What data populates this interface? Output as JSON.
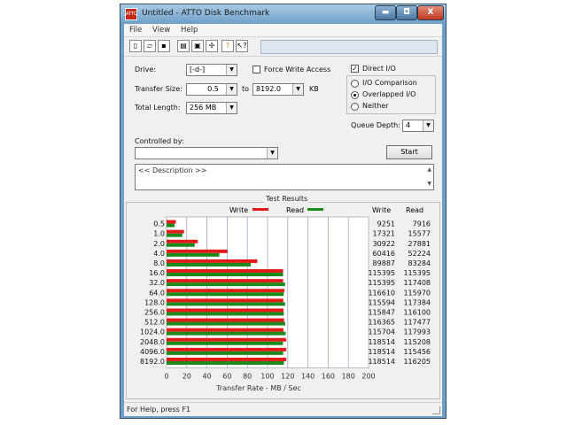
{
  "window": {
    "title": "Untitled - ATTO Disk Benchmark",
    "icon_name": "atto-app-icon",
    "controls": {
      "minimize": "▬",
      "maximize": "◘",
      "close": "X"
    }
  },
  "menu": [
    "File",
    "View",
    "Help"
  ],
  "toolbar": {
    "icons": [
      "new-document-icon",
      "open-folder-icon",
      "save-icon",
      "print-icon",
      "print-preview-icon",
      "move-icon",
      "help-icon",
      "context-help-icon"
    ],
    "glyphs": [
      "▯",
      "▱",
      "▪",
      "▤",
      "▣",
      "✢",
      "?",
      "↖?"
    ]
  },
  "settings": {
    "drive_label": "Drive:",
    "drive_value": "[-d-]",
    "force_write_label": "Force Write Access",
    "force_write_checked": false,
    "direct_io_label": "Direct I/O",
    "direct_io_checked": true,
    "transfer_size_label": "Transfer Size:",
    "transfer_min": "0.5",
    "to_label": "to",
    "transfer_max": "8192.0",
    "unit": "KB",
    "total_length_label": "Total Length:",
    "total_length_value": "256 MB",
    "io_options": [
      "I/O Comparison",
      "Overlapped I/O",
      "Neither"
    ],
    "io_selected": "Overlapped I/O",
    "queue_depth_label": "Queue Depth:",
    "queue_depth_value": "4",
    "controlled_by_label": "Controlled by:",
    "controlled_by_value": "",
    "start_label": "Start",
    "description_text": "<< Description >>"
  },
  "results": {
    "title": "Test Results",
    "legend_write": "Write",
    "legend_read": "Read",
    "col_write": "Write",
    "col_read": "Read",
    "write_color": "#e31a1a",
    "read_color": "#1a8a1a"
  },
  "chart_data": {
    "type": "bar",
    "orientation": "horizontal",
    "categories": [
      "0.5",
      "1.0",
      "2.0",
      "4.0",
      "8.0",
      "16.0",
      "32.0",
      "64.0",
      "128.0",
      "256.0",
      "512.0",
      "1024.0",
      "2048.0",
      "4096.0",
      "8192.0"
    ],
    "series": [
      {
        "name": "Write",
        "values": [
          9251,
          17321,
          30922,
          60416,
          89887,
          115395,
          115395,
          116610,
          115594,
          115847,
          116365,
          115704,
          118514,
          118514,
          118514
        ]
      },
      {
        "name": "Read",
        "values": [
          7916,
          15577,
          27881,
          52224,
          83284,
          115395,
          117408,
          115970,
          117384,
          116100,
          117477,
          117993,
          115208,
          115456,
          116205
        ]
      }
    ],
    "xlabel": "Transfer Rate - MB / Sec",
    "xlim": [
      0,
      200
    ],
    "xticks": [
      "0",
      "20",
      "40",
      "60",
      "80",
      "100",
      "120",
      "140",
      "160",
      "180",
      "200"
    ],
    "grid": true,
    "legend": "top"
  },
  "status": {
    "text": "For Help, press F1"
  }
}
